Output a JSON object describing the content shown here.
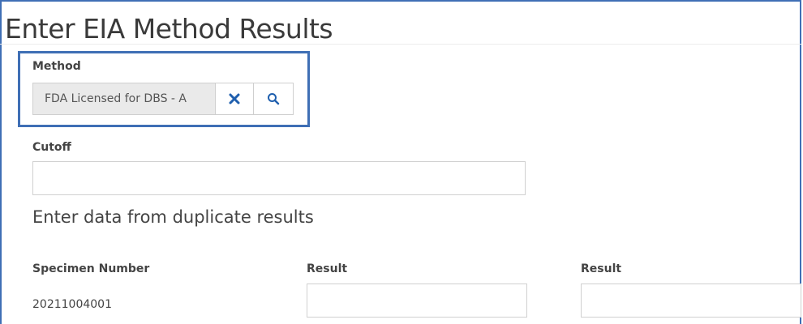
{
  "page": {
    "title": "Enter EIA Method Results"
  },
  "method": {
    "label": "Method",
    "value": "FDA Licensed for DBS - A",
    "clear_icon": "close-icon",
    "search_icon": "search-icon"
  },
  "cutoff": {
    "label": "Cutoff",
    "value": ""
  },
  "duplicate": {
    "heading": "Enter data from duplicate results"
  },
  "results": {
    "columns": [
      "Specimen Number",
      "Result",
      "Result"
    ],
    "rows": [
      {
        "specimen": "20211004001",
        "result1": "",
        "result2": ""
      }
    ]
  },
  "colors": {
    "accent": "#3f6fb5",
    "icon": "#1f5fae"
  }
}
